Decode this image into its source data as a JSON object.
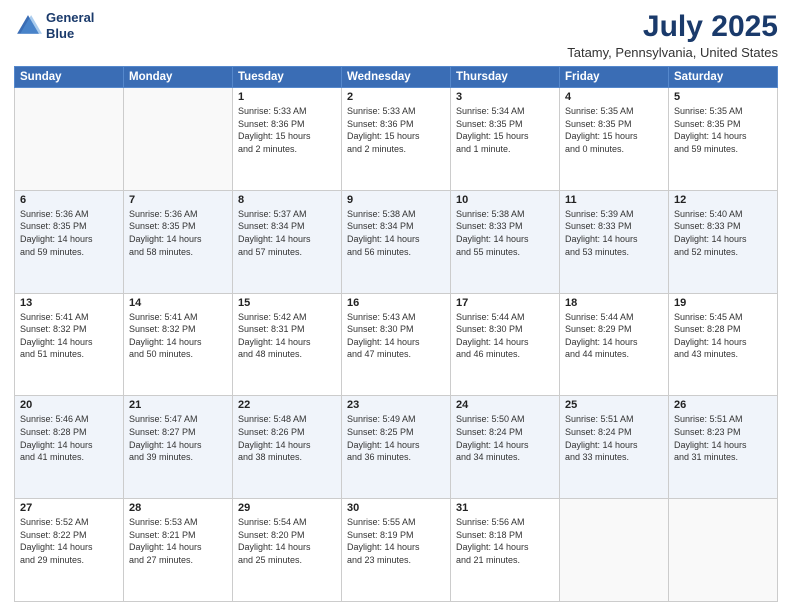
{
  "header": {
    "logo_line1": "General",
    "logo_line2": "Blue",
    "main_title": "July 2025",
    "subtitle": "Tatamy, Pennsylvania, United States"
  },
  "weekdays": [
    "Sunday",
    "Monday",
    "Tuesday",
    "Wednesday",
    "Thursday",
    "Friday",
    "Saturday"
  ],
  "weeks": [
    [
      {
        "day": "",
        "info": ""
      },
      {
        "day": "",
        "info": ""
      },
      {
        "day": "1",
        "info": "Sunrise: 5:33 AM\nSunset: 8:36 PM\nDaylight: 15 hours\nand 2 minutes."
      },
      {
        "day": "2",
        "info": "Sunrise: 5:33 AM\nSunset: 8:36 PM\nDaylight: 15 hours\nand 2 minutes."
      },
      {
        "day": "3",
        "info": "Sunrise: 5:34 AM\nSunset: 8:35 PM\nDaylight: 15 hours\nand 1 minute."
      },
      {
        "day": "4",
        "info": "Sunrise: 5:35 AM\nSunset: 8:35 PM\nDaylight: 15 hours\nand 0 minutes."
      },
      {
        "day": "5",
        "info": "Sunrise: 5:35 AM\nSunset: 8:35 PM\nDaylight: 14 hours\nand 59 minutes."
      }
    ],
    [
      {
        "day": "6",
        "info": "Sunrise: 5:36 AM\nSunset: 8:35 PM\nDaylight: 14 hours\nand 59 minutes."
      },
      {
        "day": "7",
        "info": "Sunrise: 5:36 AM\nSunset: 8:35 PM\nDaylight: 14 hours\nand 58 minutes."
      },
      {
        "day": "8",
        "info": "Sunrise: 5:37 AM\nSunset: 8:34 PM\nDaylight: 14 hours\nand 57 minutes."
      },
      {
        "day": "9",
        "info": "Sunrise: 5:38 AM\nSunset: 8:34 PM\nDaylight: 14 hours\nand 56 minutes."
      },
      {
        "day": "10",
        "info": "Sunrise: 5:38 AM\nSunset: 8:33 PM\nDaylight: 14 hours\nand 55 minutes."
      },
      {
        "day": "11",
        "info": "Sunrise: 5:39 AM\nSunset: 8:33 PM\nDaylight: 14 hours\nand 53 minutes."
      },
      {
        "day": "12",
        "info": "Sunrise: 5:40 AM\nSunset: 8:33 PM\nDaylight: 14 hours\nand 52 minutes."
      }
    ],
    [
      {
        "day": "13",
        "info": "Sunrise: 5:41 AM\nSunset: 8:32 PM\nDaylight: 14 hours\nand 51 minutes."
      },
      {
        "day": "14",
        "info": "Sunrise: 5:41 AM\nSunset: 8:32 PM\nDaylight: 14 hours\nand 50 minutes."
      },
      {
        "day": "15",
        "info": "Sunrise: 5:42 AM\nSunset: 8:31 PM\nDaylight: 14 hours\nand 48 minutes."
      },
      {
        "day": "16",
        "info": "Sunrise: 5:43 AM\nSunset: 8:30 PM\nDaylight: 14 hours\nand 47 minutes."
      },
      {
        "day": "17",
        "info": "Sunrise: 5:44 AM\nSunset: 8:30 PM\nDaylight: 14 hours\nand 46 minutes."
      },
      {
        "day": "18",
        "info": "Sunrise: 5:44 AM\nSunset: 8:29 PM\nDaylight: 14 hours\nand 44 minutes."
      },
      {
        "day": "19",
        "info": "Sunrise: 5:45 AM\nSunset: 8:28 PM\nDaylight: 14 hours\nand 43 minutes."
      }
    ],
    [
      {
        "day": "20",
        "info": "Sunrise: 5:46 AM\nSunset: 8:28 PM\nDaylight: 14 hours\nand 41 minutes."
      },
      {
        "day": "21",
        "info": "Sunrise: 5:47 AM\nSunset: 8:27 PM\nDaylight: 14 hours\nand 39 minutes."
      },
      {
        "day": "22",
        "info": "Sunrise: 5:48 AM\nSunset: 8:26 PM\nDaylight: 14 hours\nand 38 minutes."
      },
      {
        "day": "23",
        "info": "Sunrise: 5:49 AM\nSunset: 8:25 PM\nDaylight: 14 hours\nand 36 minutes."
      },
      {
        "day": "24",
        "info": "Sunrise: 5:50 AM\nSunset: 8:24 PM\nDaylight: 14 hours\nand 34 minutes."
      },
      {
        "day": "25",
        "info": "Sunrise: 5:51 AM\nSunset: 8:24 PM\nDaylight: 14 hours\nand 33 minutes."
      },
      {
        "day": "26",
        "info": "Sunrise: 5:51 AM\nSunset: 8:23 PM\nDaylight: 14 hours\nand 31 minutes."
      }
    ],
    [
      {
        "day": "27",
        "info": "Sunrise: 5:52 AM\nSunset: 8:22 PM\nDaylight: 14 hours\nand 29 minutes."
      },
      {
        "day": "28",
        "info": "Sunrise: 5:53 AM\nSunset: 8:21 PM\nDaylight: 14 hours\nand 27 minutes."
      },
      {
        "day": "29",
        "info": "Sunrise: 5:54 AM\nSunset: 8:20 PM\nDaylight: 14 hours\nand 25 minutes."
      },
      {
        "day": "30",
        "info": "Sunrise: 5:55 AM\nSunset: 8:19 PM\nDaylight: 14 hours\nand 23 minutes."
      },
      {
        "day": "31",
        "info": "Sunrise: 5:56 AM\nSunset: 8:18 PM\nDaylight: 14 hours\nand 21 minutes."
      },
      {
        "day": "",
        "info": ""
      },
      {
        "day": "",
        "info": ""
      }
    ]
  ]
}
